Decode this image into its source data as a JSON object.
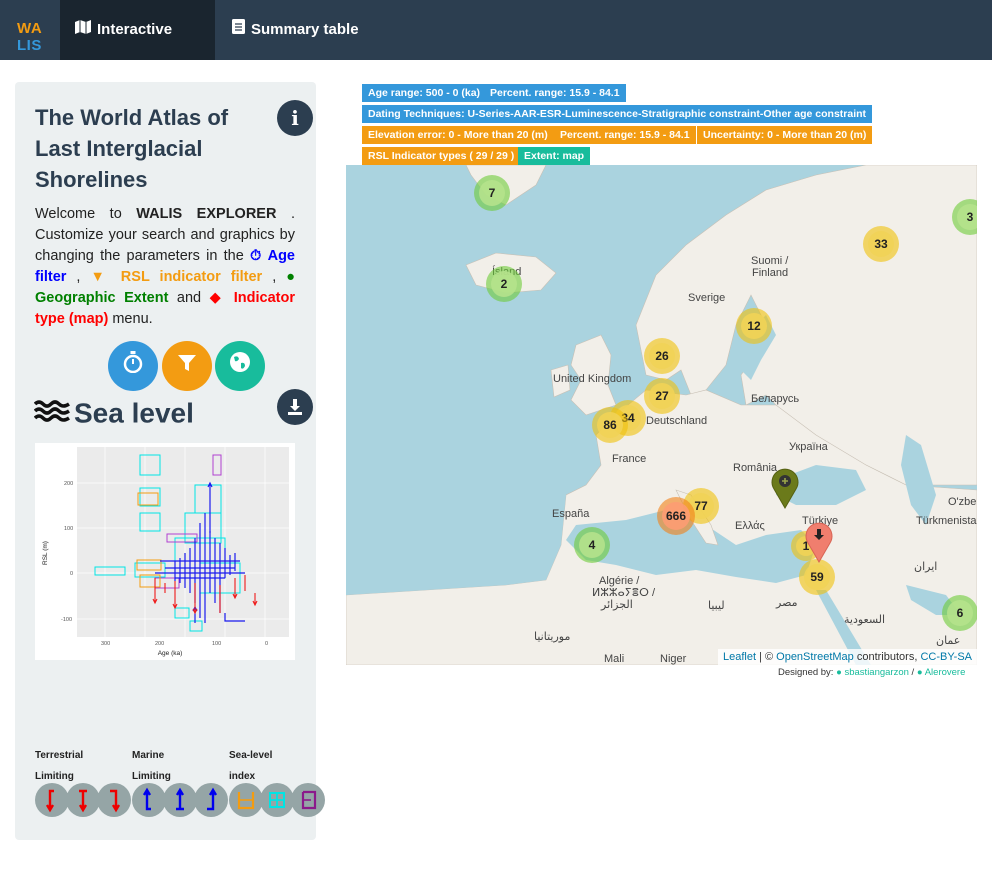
{
  "nav": {
    "brand_top": "WA",
    "brand_bottom": "LIS",
    "tab_map": "Interactive map",
    "tab_table": "Summary table"
  },
  "sidebar": {
    "title": "The World Atlas of Last Interglacial Shorelines",
    "info_icon_label": "i",
    "welcome_1": "Welcome to ",
    "welcome_bold": "WALIS EXPLORER",
    "welcome_2": " . Customize your search and graphics by changing the parameters in the ",
    "age_filter": "Age filter",
    "sep_1": " , ",
    "rsl_filter": "RSL indicator filter",
    "sep_2": " , ",
    "geo_extent": "Geographic Extent",
    "and": " and ",
    "indicator_type": "Indicator type (map)",
    "menu": " menu.",
    "sea_level_title": "Sea level",
    "legend": {
      "terrestrial_1": "Terrestrial",
      "terrestrial_2": "Limiting",
      "marine_1": "Marine",
      "marine_2": "Limiting",
      "sealevel_1": "Sea-level",
      "sealevel_2": "index"
    },
    "plot": {
      "xlabel": "Age (ka)",
      "ylabel": "RSL (m)",
      "xticks": [
        "300",
        "200",
        "100",
        "0"
      ],
      "yticks": [
        "200",
        "100",
        "0",
        "-100"
      ]
    }
  },
  "filters": {
    "age_range": "Age range: 500 - 0 (ka)",
    "percent_range_1": "Percent. range: 15.9 - 84.1",
    "dating": "Dating Techniques: U-Series-AAR-ESR-Luminescence-Stratigraphic constraint-Other age constraint",
    "elevation_error": "Elevation error: 0 - More than 20 (m)",
    "percent_range_2": "Percent. range: 15.9 - 84.1",
    "uncertainty": "Uncertainty: 0 - More than 20 (m)",
    "rsl_types": "RSL Indicator types ( 29 / 29 )",
    "extent": "Extent: map"
  },
  "map": {
    "clusters": [
      "7",
      "3",
      "33",
      "2",
      "12",
      "26",
      "27",
      "34",
      "86",
      "77",
      "666",
      "4",
      "59",
      "6",
      "1"
    ],
    "labels": {
      "island": "Ísland",
      "suomi": "Suomi /",
      "finland": "Finland",
      "sverige": "Sverige",
      "uk": "United Kingdom",
      "belarus": "Беларусь",
      "deutschland": "Deutschland",
      "ukraina": "Україна",
      "france": "France",
      "romania": "România",
      "espana": "España",
      "ellas": "Ελλάς",
      "turkiye": "Türkiye",
      "ozbe": "O'zbe",
      "turkmenista": "Türkmenista",
      "iran": "ایران",
      "algerie_1": "Algérie /",
      "algerie_2": "ⵍⵣⵣⴰⵢⴻⵔ /",
      "algerie_3": "الجزائر",
      "libya": "ليبيا",
      "misr": "مصر",
      "saudi": "السعودية",
      "mauritania": "موريتانيا",
      "oman": "عمان",
      "mali": "Mali",
      "niger": "Niger"
    },
    "attribution_leaflet": "Leaflet",
    "attribution_sep": " | © ",
    "attribution_osm": "OpenStreetMap",
    "attribution_contrib": " contributors, ",
    "attribution_license": "CC-BY-SA"
  },
  "designed": {
    "prefix": "Designed by: ",
    "author_1": "sbastiangarzon",
    "sep": " / ",
    "author_2": "Alerovere"
  },
  "colors": {
    "navbar": "#2c3e50",
    "blue": "#3498db",
    "orange": "#f39c12",
    "teal": "#18bc9c"
  }
}
